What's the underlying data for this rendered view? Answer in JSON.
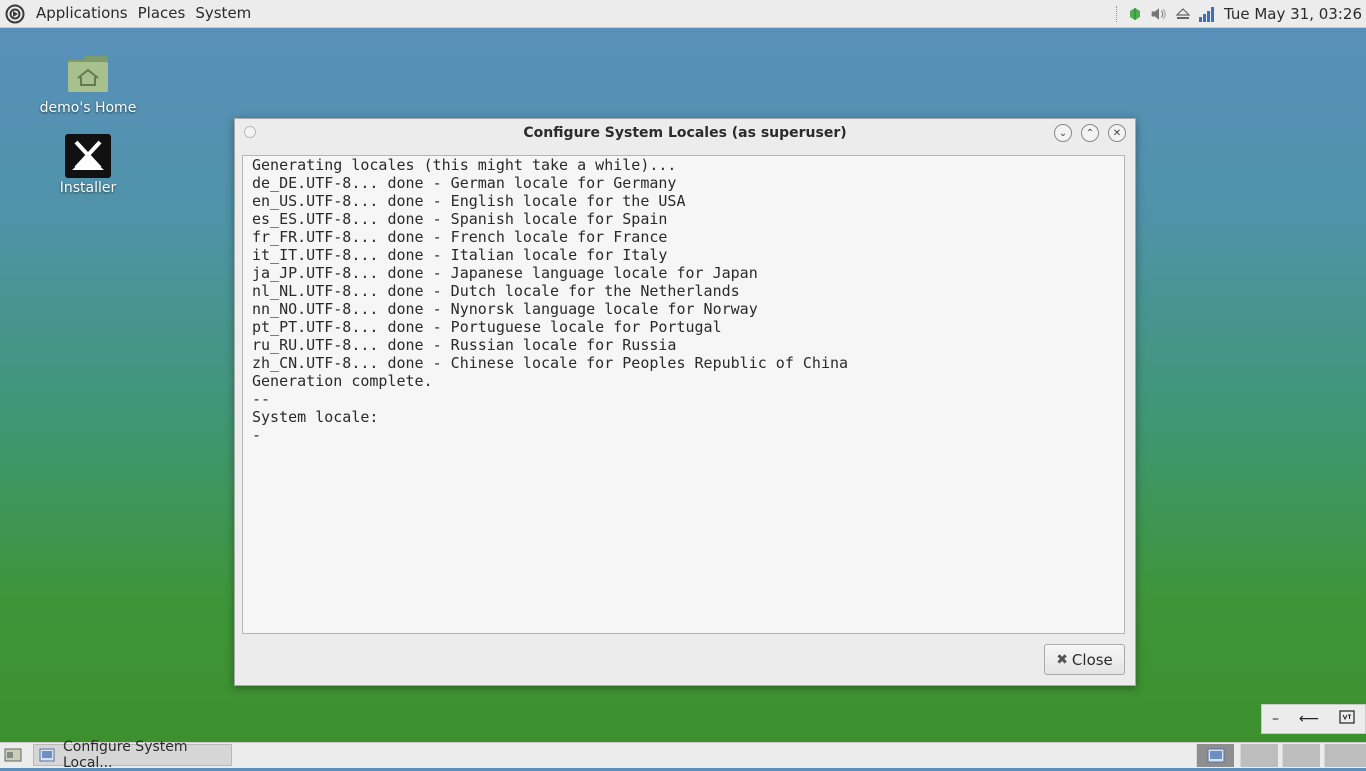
{
  "top_panel": {
    "menus": [
      "Applications",
      "Places",
      "System"
    ],
    "clock": "Tue May 31, 03:26",
    "tray_icons": [
      "network-icon",
      "volume-icon",
      "eject-icon",
      "signal-icon"
    ]
  },
  "desktop": {
    "icons": [
      {
        "label": "demo's Home",
        "icon": "home-folder-icon"
      },
      {
        "label": "Installer",
        "icon": "installer-icon"
      }
    ]
  },
  "window": {
    "title": "Configure System Locales (as superuser)",
    "terminal_lines": [
      "Generating locales (this might take a while)...",
      "de_DE.UTF-8... done - German locale for Germany",
      "en_US.UTF-8... done - English locale for the USA",
      "es_ES.UTF-8... done - Spanish locale for Spain",
      "fr_FR.UTF-8... done - French locale for France",
      "it_IT.UTF-8... done - Italian locale for Italy",
      "ja_JP.UTF-8... done - Japanese language locale for Japan",
      "nl_NL.UTF-8... done - Dutch locale for the Netherlands",
      "nn_NO.UTF-8... done - Nynorsk language locale for Norway",
      "pt_PT.UTF-8... done - Portuguese locale for Portugal",
      "ru_RU.UTF-8... done - Russian locale for Russia",
      "zh_CN.UTF-8... done - Chinese locale for Peoples Republic of China",
      "Generation complete.",
      "--",
      "System locale:",
      "-"
    ],
    "close_label": "Close"
  },
  "bottom_panel": {
    "task_label": "Configure System Local..."
  }
}
